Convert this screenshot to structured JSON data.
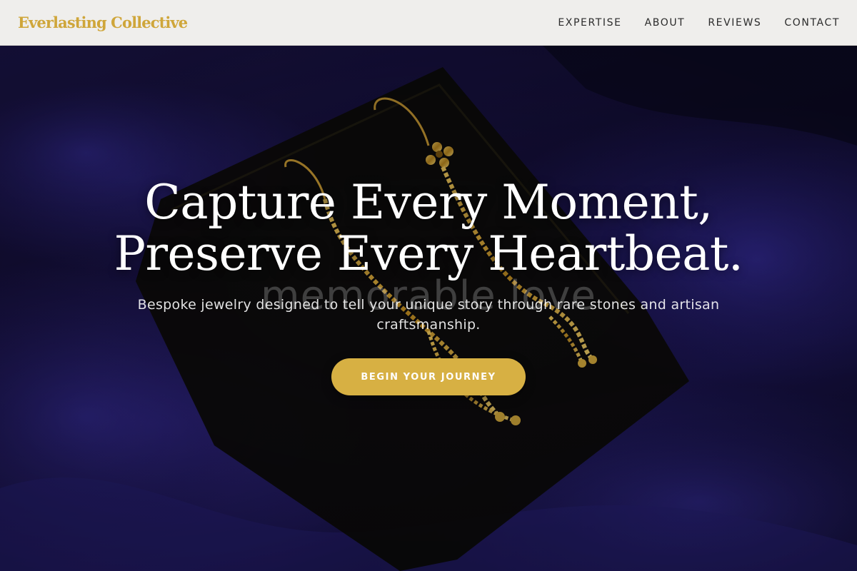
{
  "nav": {
    "brand": "Everlasting Collective",
    "links": [
      "EXPERTISE",
      "ABOUT",
      "REVIEWS",
      "CONTACT"
    ]
  },
  "hero": {
    "title_line1": "Capture Every Moment,",
    "title_line2": "Preserve Every Heartbeat.",
    "watermark": "memorable love",
    "subtitle": "Bespoke jewelry designed to tell your unique story through rare stones and artisan craftsmanship.",
    "cta_label": "BEGIN YOUR JOURNEY"
  },
  "colors": {
    "brand_gold": "#cfa63a",
    "cta_gold": "#d7b043",
    "nav_background": "#efeeec",
    "velvet_blue": "#1d1650"
  }
}
